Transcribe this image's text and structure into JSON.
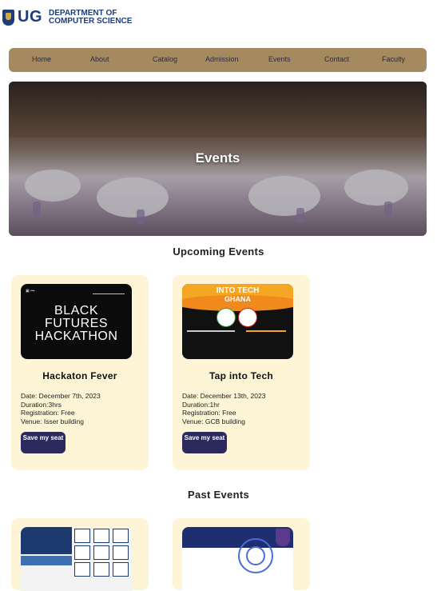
{
  "header": {
    "logo_text": "UG",
    "department_line1": "DEPARTMENT OF",
    "department_line2": "COMPUTER SCIENCE"
  },
  "nav": {
    "items": [
      "Home",
      "About",
      "Catalog",
      "Admission",
      "Events",
      "Contact",
      "Faculty"
    ]
  },
  "hero": {
    "title": "Events"
  },
  "upcoming": {
    "title": "Upcoming Events",
    "events": [
      {
        "title": "Hackaton Fever",
        "date": "Date: December 7th, 2023",
        "duration": "Duration:3hrs",
        "registration": "Registration: Free",
        "venue": "Venue: Isser building",
        "button": "Save my seat",
        "image_text": [
          "BLACK",
          "FUTURES",
          "HACKATHON"
        ]
      },
      {
        "title": "Tap into Tech",
        "date": "Date: December 13th, 2023",
        "duration": "Duration:1hr",
        "registration": "Registration: Free",
        "venue": "Venue: GCB building",
        "button": "Save my seat",
        "image_text": [
          "INTO TECH",
          "GHANA"
        ]
      }
    ]
  },
  "past": {
    "title": "Past Events"
  },
  "colors": {
    "nav_bg": "#a58a5f",
    "card_bg": "#fdf5d6",
    "button_bg": "#2c2a5c",
    "brand_blue": "#1c3d7a"
  }
}
